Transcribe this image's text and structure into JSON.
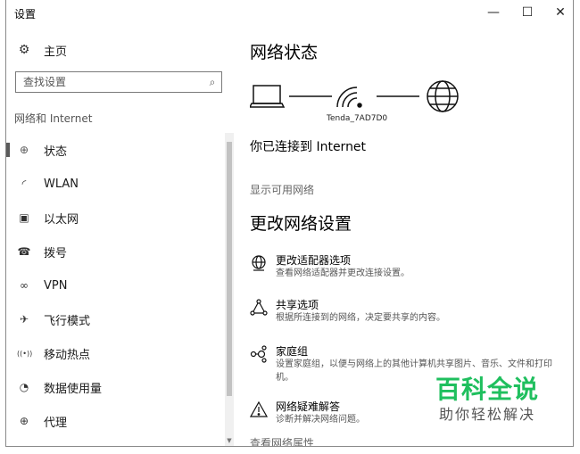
{
  "window": {
    "title": "设置",
    "minimize": "—",
    "maximize": "☐",
    "close": "✕"
  },
  "sidebar": {
    "home_label": "主页",
    "search_placeholder": "查找设置",
    "section": "网络和 Internet",
    "items": [
      {
        "label": "状态",
        "icon": "globe-icon",
        "glyph": "⊕",
        "active": true
      },
      {
        "label": "WLAN",
        "icon": "wifi-icon",
        "glyph": "◜",
        "active": false
      },
      {
        "label": "以太网",
        "icon": "ethernet-icon",
        "glyph": "▣",
        "active": false
      },
      {
        "label": "拨号",
        "icon": "dialup-icon",
        "glyph": "☎",
        "active": false
      },
      {
        "label": "VPN",
        "icon": "vpn-icon",
        "glyph": "∞",
        "active": false
      },
      {
        "label": "飞行模式",
        "icon": "airplane-icon",
        "glyph": "✈",
        "active": false
      },
      {
        "label": "移动热点",
        "icon": "hotspot-icon",
        "glyph": "((•))",
        "active": false
      },
      {
        "label": "数据使用量",
        "icon": "data-usage-icon",
        "glyph": "◔",
        "active": false
      },
      {
        "label": "代理",
        "icon": "proxy-icon",
        "glyph": "⊕",
        "active": false
      }
    ]
  },
  "main": {
    "title": "网络状态",
    "network_name": "Tenda_7AD7D0",
    "status": "你已连接到 Internet",
    "show_networks": "显示可用网络",
    "change_title": "更改网络设置",
    "options": [
      {
        "title": "更改适配器选项",
        "desc": "查看网络适配器并更改连接设置。",
        "icon": "adapter-globe-icon"
      },
      {
        "title": "共享选项",
        "desc": "根据所连接到的网络，决定要共享的内容。",
        "icon": "sharing-icon"
      },
      {
        "title": "家庭组",
        "desc": "设置家庭组，以便与网络上的其他计算机共享图片、音乐、文件和打印机。",
        "icon": "homegroup-icon"
      },
      {
        "title": "网络疑难解答",
        "desc": "诊断并解决网络问题。",
        "icon": "warning-icon"
      }
    ],
    "properties_link": "查看网络属性"
  },
  "watermark": {
    "line1": "百科全说",
    "line2": "助你轻松解决"
  }
}
